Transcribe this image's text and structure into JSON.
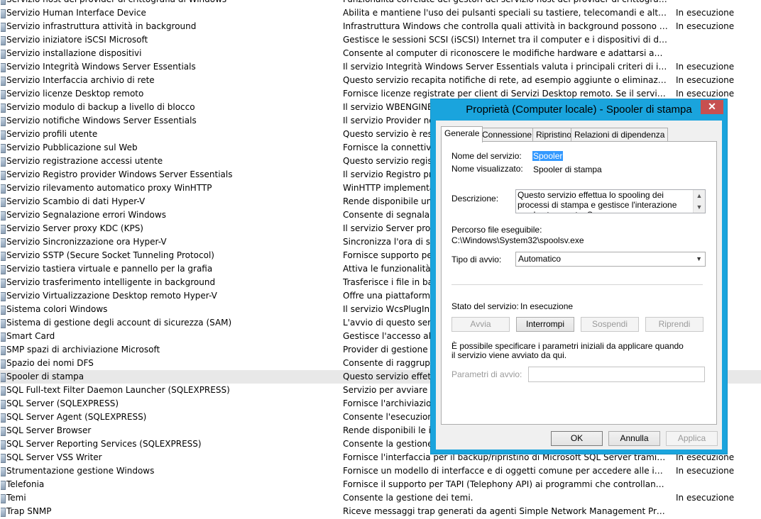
{
  "services": [
    {
      "name": "Servizio host del provider di crittografia di Windows",
      "description": "Funzionalità correlate dei gestori del servizio host del provider di crittografia di Windo...",
      "status": ""
    },
    {
      "name": "Servizio Human Interface Device",
      "description": "Abilita e mantiene l'uso dei pulsanti speciali su tastiere, telecomandi e altri dispositivi...",
      "status": "In esecuzione"
    },
    {
      "name": "Servizio infrastruttura attività in background",
      "description": "Infrastruttura Windows che controlla quali attività in background possono essere ese...",
      "status": "In esecuzione"
    },
    {
      "name": "Servizio iniziatore iSCSI Microsoft",
      "description": "Gestisce le sessioni SCSI (iSCSI) Internet tra il computer e i dispositivi di destinazione i...",
      "status": ""
    },
    {
      "name": "Servizio installazione dispositivi",
      "description": "Consente al computer di riconoscere le modifiche hardware e adattarsi ad esse con u...",
      "status": ""
    },
    {
      "name": "Servizio Integrità Windows Server Essentials",
      "description": "Il servizio Integrità Windows Server Essentials valuta i principali criteri di integrità e ge...",
      "status": "In esecuzione"
    },
    {
      "name": "Servizio Interfaccia archivio di rete",
      "description": "Questo servizio recapita notifiche di rete, ad esempio aggiunte o eliminazioni di elem...",
      "status": "In esecuzione"
    },
    {
      "name": "Servizio licenze Desktop remoto",
      "description": "Fornisce licenze registrate per client di Servizi Desktop remoto. Se il servizio è arrestat...",
      "status": "In esecuzione"
    },
    {
      "name": "Servizio modulo di backup a livello di blocco",
      "description": "Il servizio WBENGINE vi",
      "status": ""
    },
    {
      "name": "Servizio notifiche Windows Server Essentials",
      "description": "Il servizio Provider notif",
      "status": ""
    },
    {
      "name": "Servizio profili utente",
      "description": "Questo servizio è respo",
      "status": ""
    },
    {
      "name": "Servizio Pubblicazione sul Web",
      "description": "Fornisce la connettività",
      "status": ""
    },
    {
      "name": "Servizio registrazione accessi utente",
      "description": "Questo servizio registra",
      "status": ""
    },
    {
      "name": "Servizio Registro provider Windows Server Essentials",
      "description": "Il servizio Registro provi",
      "status": ""
    },
    {
      "name": "Servizio rilevamento automatico proxy WinHTTP",
      "description": "WinHTTP implementa l",
      "status": ""
    },
    {
      "name": "Servizio Scambio di dati Hyper-V",
      "description": "Rende disponibile un m",
      "status": ""
    },
    {
      "name": "Servizio Segnalazione errori Windows",
      "description": "Consente di segnalare g",
      "status": ""
    },
    {
      "name": "Servizio Server proxy KDC (KPS)",
      "description": "Il servizio Server proxy K",
      "status": ""
    },
    {
      "name": "Servizio Sincronizzazione ora Hyper-V",
      "description": "Sincronizza l'ora di siste",
      "status": ""
    },
    {
      "name": "Servizio SSTP (Secure Socket Tunneling Protocol)",
      "description": "Fornisce supporto per il",
      "status": ""
    },
    {
      "name": "Servizio tastiera virtuale e pannello per la grafia",
      "description": "Attiva le funzionalità di",
      "status": ""
    },
    {
      "name": "Servizio trasferimento intelligente in background",
      "description": "Trasferisce i file in back",
      "status": ""
    },
    {
      "name": "Servizio Virtualizzazione Desktop remoto Hyper-V",
      "description": "Offre una piattaforma p",
      "status": ""
    },
    {
      "name": "Sistema colori Windows",
      "description": "Il servizio WcsPlugInSer",
      "status": ""
    },
    {
      "name": "Sistema di gestione degli account di sicurezza (SAM)",
      "description": "L'avvio di questo servizi",
      "status": ""
    },
    {
      "name": "Smart Card",
      "description": "Gestisce l'accesso alle s",
      "status": ""
    },
    {
      "name": "SMP spazi di archiviazione Microsoft",
      "description": "Provider di gestione per",
      "status": ""
    },
    {
      "name": "Spazio dei nomi DFS",
      "description": "Consente di raggruppar",
      "status": ""
    },
    {
      "name": "Spooler di stampa",
      "description": "Questo servizio effettua",
      "status": ""
    },
    {
      "name": "SQL Full-text Filter Daemon Launcher (SQLEXPRESS)",
      "description": "Servizio per avviare il pr",
      "status": ""
    },
    {
      "name": "SQL Server (SQLEXPRESS)",
      "description": "Fornisce l'archiviazione",
      "status": ""
    },
    {
      "name": "SQL Server Agent (SQLEXPRESS)",
      "description": "Consente l'esecuzione d",
      "status": ""
    },
    {
      "name": "SQL Server Browser",
      "description": "Rende disponibili le info",
      "status": ""
    },
    {
      "name": "SQL Server Reporting Services (SQLEXPRESS)",
      "description": "Consente la gestione, l'",
      "status": ""
    },
    {
      "name": "SQL Server VSS Writer",
      "description": "Fornisce l'interfaccia per il backup/ripristino di Microsoft SQL Server tramite l'infrastr...",
      "status": "In esecuzione"
    },
    {
      "name": "Strumentazione gestione Windows",
      "description": "Fornisce un modello di interfacce e di oggetti comune per accedere alle informazioni...",
      "status": "In esecuzione"
    },
    {
      "name": "Telefonia",
      "description": "Fornisce il supporto per TAPI (Telephony API) ai programmi che controllano i disposi...",
      "status": ""
    },
    {
      "name": "Temi",
      "description": "Consente la gestione dei temi.",
      "status": "In esecuzione"
    },
    {
      "name": "Trap SNMP",
      "description": "Riceve messaggi trap generati da agenti Simple Network Management Protocol (SN...",
      "status": ""
    }
  ],
  "selected_service_index": 28,
  "dialog": {
    "title": "Proprietà (Computer locale) - Spooler di stampa",
    "close_glyph": "✕",
    "tabs": [
      "Generale",
      "Connessione",
      "Ripristino",
      "Relazioni di dipendenza"
    ],
    "active_tab": 0,
    "service_name_label": "Nome del servizio:",
    "service_name_value": "Spooler",
    "display_name_label": "Nome visualizzato:",
    "display_name_value": "Spooler di stampa",
    "description_label": "Descrizione:",
    "description_value": "Questo servizio effettua lo spooling dei processi di stampa e gestisce l'interazione con la stampante. Se",
    "exe_path_label": "Percorso file eseguibile:",
    "exe_path_value": "C:\\Windows\\System32\\spoolsv.exe",
    "startup_type_label": "Tipo di avvio:",
    "startup_type_value": "Automatico",
    "service_status_label": "Stato del servizio:",
    "service_status_value": "In esecuzione",
    "buttons": {
      "start": "Avvia",
      "stop": "Interrompi",
      "pause": "Sospendi",
      "resume": "Riprendi"
    },
    "start_params_hint": "È possibile specificare i parametri iniziali da applicare quando il servizio viene avviato da qui.",
    "start_params_label": "Parametri di avvio:",
    "start_params_value": "",
    "footer": {
      "ok": "OK",
      "cancel": "Annulla",
      "apply": "Applica"
    }
  }
}
